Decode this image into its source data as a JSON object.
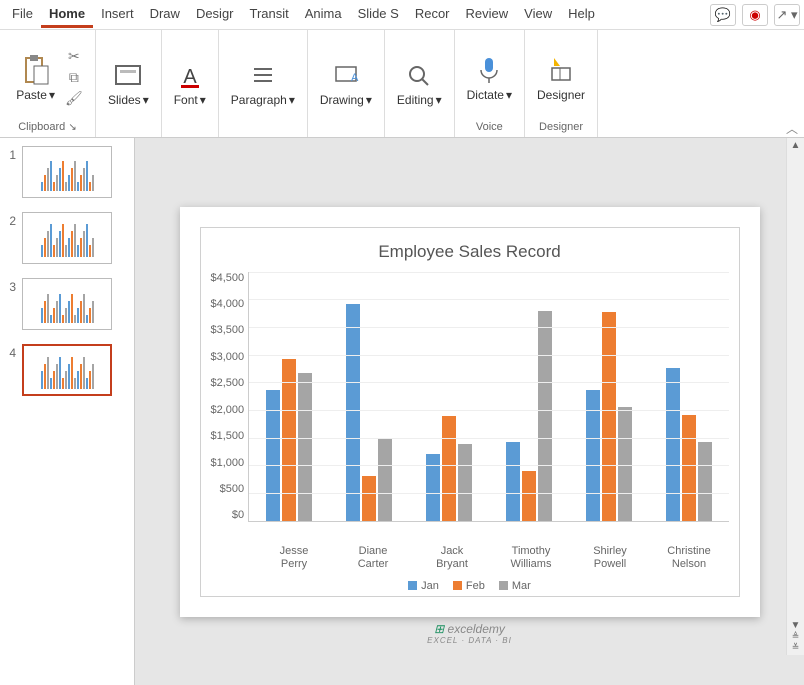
{
  "menu": {
    "items": [
      "File",
      "Home",
      "Insert",
      "Draw",
      "Desigr",
      "Transit",
      "Anima",
      "Slide S",
      "Recor",
      "Review",
      "View",
      "Help"
    ],
    "active": 1
  },
  "ribbon": {
    "groups": [
      {
        "name": "clipboard",
        "label": "Clipboard",
        "main": "Paste"
      },
      {
        "name": "slides",
        "label": "",
        "main": "Slides"
      },
      {
        "name": "font",
        "label": "",
        "main": "Font"
      },
      {
        "name": "paragraph",
        "label": "",
        "main": "Paragraph"
      },
      {
        "name": "drawing",
        "label": "",
        "main": "Drawing"
      },
      {
        "name": "editing",
        "label": "",
        "main": "Editing"
      },
      {
        "name": "voice",
        "label": "Voice",
        "main": "Dictate"
      },
      {
        "name": "designer",
        "label": "Designer",
        "main": "Designer"
      }
    ]
  },
  "thumbs": {
    "count": 4,
    "selected": 4
  },
  "chart_data": {
    "type": "bar",
    "title": "Employee Sales Record",
    "categories": [
      "Jesse Perry",
      "Diane Carter",
      "Jack Bryant",
      "Timothy Williams",
      "Shirley Powell",
      "Christine Nelson"
    ],
    "series": [
      {
        "name": "Jan",
        "color": "#5b9bd5",
        "values": [
          2350,
          3900,
          1200,
          1420,
          2350,
          2750
        ]
      },
      {
        "name": "Feb",
        "color": "#ed7d31",
        "values": [
          2900,
          800,
          1880,
          900,
          3750,
          1900
        ]
      },
      {
        "name": "Mar",
        "color": "#a5a5a5",
        "values": [
          2650,
          1480,
          1380,
          3780,
          2050,
          1420
        ]
      }
    ],
    "ylim": [
      0,
      4500
    ],
    "yticks": [
      "$4,500",
      "$4,000",
      "$3,500",
      "$3,000",
      "$2,500",
      "$2,000",
      "$1,500",
      "$1,000",
      "$500",
      "$0"
    ],
    "xlabel": "",
    "ylabel": ""
  },
  "watermark": {
    "brand": "exceldemy",
    "tag": "EXCEL · DATA · BI"
  }
}
